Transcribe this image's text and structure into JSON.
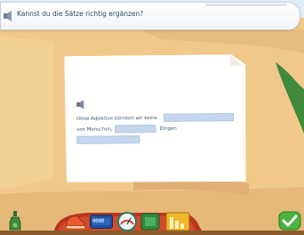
{
  "instruction": {
    "text": "Kannst du die Sätze richtig ergänzen?"
  },
  "exercise": {
    "line1": "Ohne Adjektive könnten wir keine",
    "line2_prefix": "von Menschen,",
    "line2_mid": ", Dingen",
    "line3_suffix": "."
  },
  "toolbar": {
    "counter": "0000",
    "icons": [
      "bottle-icon",
      "shoe-icon",
      "counter-icon",
      "gauge-icon",
      "book-icon",
      "bars-icon",
      "check-icon"
    ]
  },
  "colors": {
    "sand": "#f2cf91",
    "sky": "#dbe8f3",
    "green_hill": "#3f8a3a",
    "gap_fill": "#c5d6ef",
    "toolbar_red": "#b8361f",
    "check_green": "#4ab43c"
  }
}
